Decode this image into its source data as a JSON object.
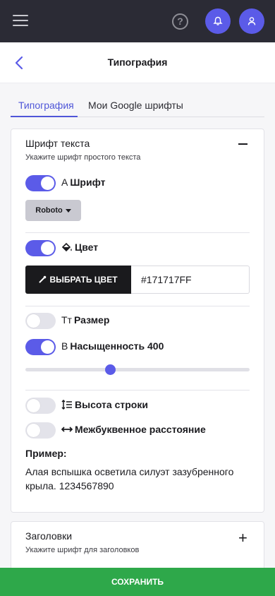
{
  "topbar": {
    "help_label": "?"
  },
  "page": {
    "title": "Типография"
  },
  "tabs": [
    {
      "label": "Типография"
    },
    {
      "label": "Мои Google шрифты"
    }
  ],
  "body_font": {
    "title": "Шрифт текста",
    "subtitle": "Укажите шрифт простого текста",
    "font": {
      "label": "Шрифт",
      "icon": "A",
      "enabled": true,
      "value": "Roboto"
    },
    "color": {
      "label": "Цвет",
      "enabled": true,
      "button_label": "ВЫБРАТЬ ЦВЕТ",
      "value": "#171717FF"
    },
    "size": {
      "label": "Размер",
      "icon": "Tт",
      "enabled": false
    },
    "weight": {
      "label": "Насыщенность 400",
      "icon": "B",
      "enabled": true
    },
    "line_height": {
      "label": "Высота строки",
      "enabled": false
    },
    "letter_spacing": {
      "label": "Межбуквенное расстояние",
      "enabled": false
    },
    "sample_label": "Пример:",
    "sample_text": "Алая вспышка осветила силуэт зазубренного крыла. 1234567890"
  },
  "headings": {
    "title": "Заголовки",
    "subtitle": "Укажите шрифт для заголовков",
    "expand_label": "+"
  },
  "save_label": "СОХРАНИТЬ",
  "colors": {
    "accent": "#5b5be8",
    "topbar": "#2b2b35",
    "save": "#2ea84a"
  }
}
